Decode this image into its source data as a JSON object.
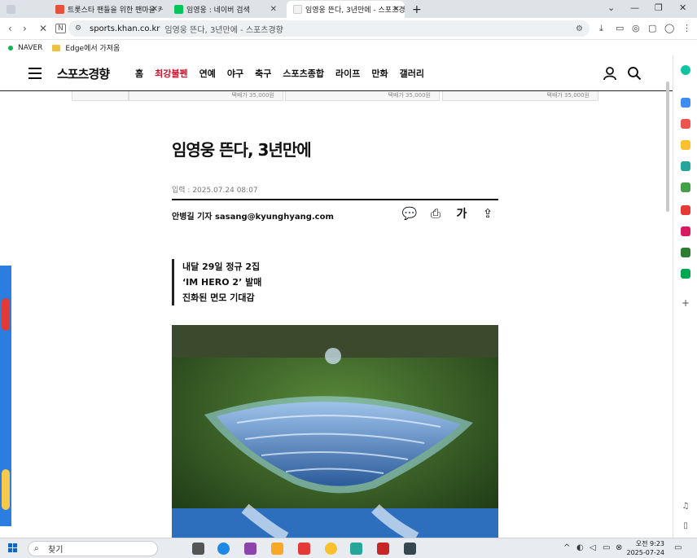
{
  "browser": {
    "tabs": [
      {
        "label": "트롯스타 팬들을 위한 팬마을 커",
        "favicon_color": "#e5533d"
      },
      {
        "label": "임영웅 : 네이버 검색",
        "favicon_color": "#03c75a"
      },
      {
        "label": "임영웅 뜬다, 3년만에 - 스포츠경",
        "favicon_color": "#f2f2f2"
      }
    ],
    "new_tab_label": "+",
    "url_host": "sports.khan.co.kr",
    "url_title": "임영웅 뜬다, 3년만에 - 스포츠경향",
    "bookmarks": [
      {
        "label": "NAVER",
        "icon": "naver-dot-icon"
      },
      {
        "label": "Edge에서 가져옴",
        "icon": "folder-icon"
      }
    ]
  },
  "site": {
    "logo": "스포츠경향",
    "menu": [
      {
        "label": "홈",
        "hot": false
      },
      {
        "label": "최강불펜",
        "hot": true
      },
      {
        "label": "연예",
        "hot": false
      },
      {
        "label": "야구",
        "hot": false
      },
      {
        "label": "축구",
        "hot": false
      },
      {
        "label": "스포츠종합",
        "hot": false
      },
      {
        "label": "라이프",
        "hot": false
      },
      {
        "label": "만화",
        "hot": false
      },
      {
        "label": "갤러리",
        "hot": false
      }
    ],
    "ad_prices": [
      "택배가 35,000원",
      "택배가 35,000원",
      "택배가 35,000원"
    ]
  },
  "article": {
    "headline": "임영웅 뜬다, 3년만에",
    "date": "입력 : 2025.07.24 08:07",
    "byline": "안병길 기자 sasang@kyunghyang.com",
    "tools": [
      {
        "name": "comment-icon",
        "glyph": "💬"
      },
      {
        "name": "print-icon",
        "glyph": "⎙"
      },
      {
        "name": "font-size-icon",
        "glyph": "가"
      },
      {
        "name": "share-icon",
        "glyph": "⇪"
      }
    ],
    "subhead": [
      "내달 29일 정규 2집",
      "‘IM HERO 2’ 발매",
      "진화된 면모 기대감"
    ]
  },
  "taskbar": {
    "search_label": "찾기",
    "time": "오전 9:23",
    "date": "2025-07-24"
  },
  "colors": {
    "accent_red": "#d0112b",
    "tabbar_bg": "#dfe3e8"
  }
}
